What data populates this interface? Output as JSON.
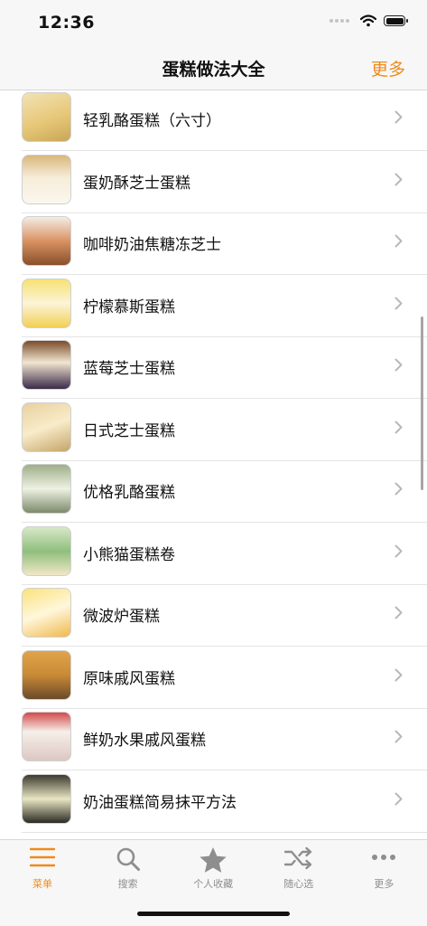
{
  "status_bar": {
    "time": "12:36"
  },
  "nav": {
    "title": "蛋糕做法大全",
    "more_label": "更多"
  },
  "recipes": [
    {
      "title": "轻乳酪蛋糕（六寸）"
    },
    {
      "title": "蛋奶酥芝士蛋糕"
    },
    {
      "title": "咖啡奶油焦糖冻芝士"
    },
    {
      "title": "柠檬慕斯蛋糕"
    },
    {
      "title": "蓝莓芝士蛋糕"
    },
    {
      "title": "日式芝士蛋糕"
    },
    {
      "title": "优格乳酪蛋糕"
    },
    {
      "title": "小熊猫蛋糕卷"
    },
    {
      "title": "微波炉蛋糕"
    },
    {
      "title": "原味戚风蛋糕"
    },
    {
      "title": "鲜奶水果戚风蛋糕"
    },
    {
      "title": "奶油蛋糕简易抹平方法"
    }
  ],
  "tabs": [
    {
      "label": "菜单",
      "icon": "menu-icon",
      "active": true
    },
    {
      "label": "搜索",
      "icon": "search-icon",
      "active": false
    },
    {
      "label": "个人收藏",
      "icon": "star-icon",
      "active": false
    },
    {
      "label": "随心选",
      "icon": "shuffle-icon",
      "active": false
    },
    {
      "label": "更多",
      "icon": "more-icon",
      "active": false
    }
  ],
  "colors": {
    "accent": "#ef8a1a",
    "inactive": "#8e8e8e",
    "bar_background": "#f7f7f7"
  }
}
